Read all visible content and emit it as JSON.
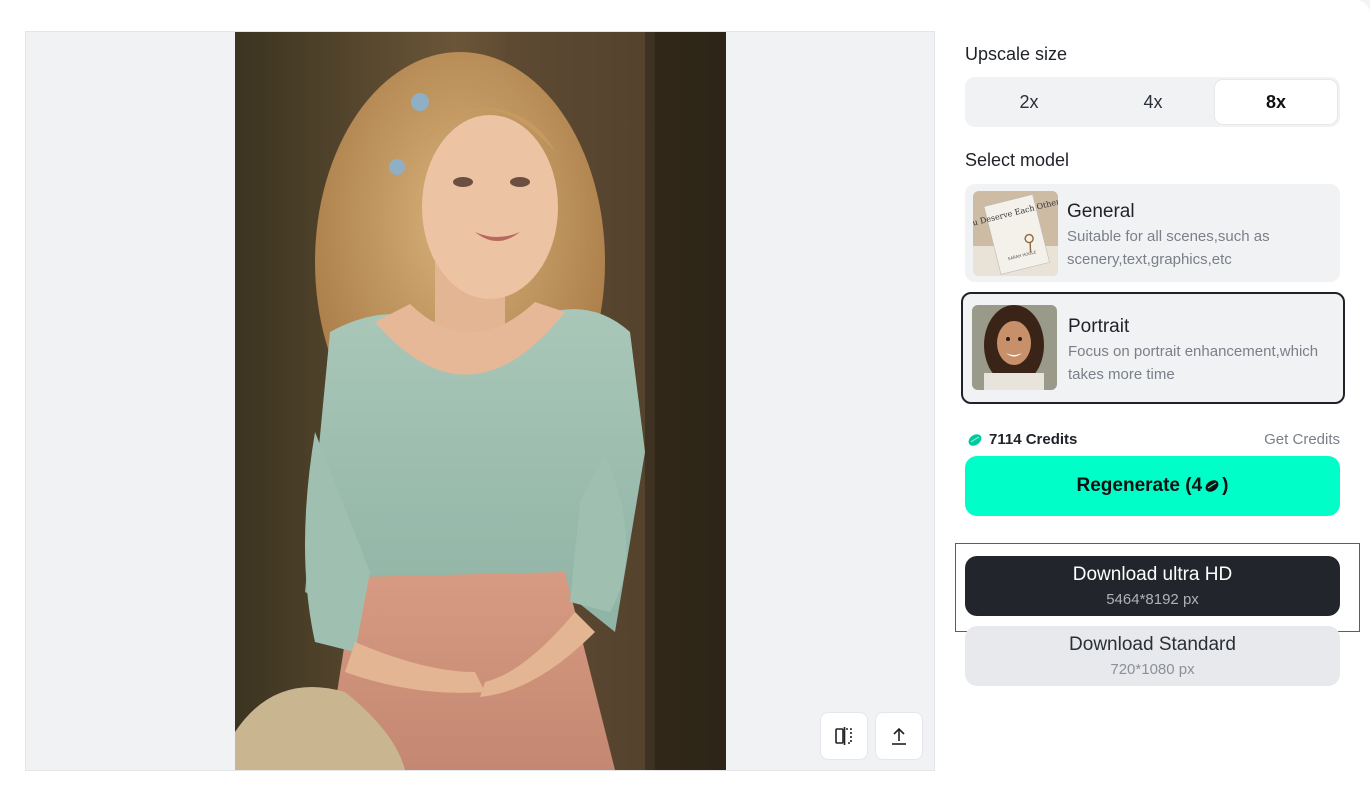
{
  "upscale": {
    "label": "Upscale size",
    "options": [
      "2x",
      "4x",
      "8x"
    ],
    "selected": "8x"
  },
  "model": {
    "label": "Select model",
    "items": [
      {
        "title": "General",
        "desc": "Suitable for all scenes,such as scenery,text,graphics,etc",
        "thumb_text": "You Deserve Each Other",
        "thumb_sub": "SARAH HOGLE"
      },
      {
        "title": "Portrait",
        "desc": "Focus on portrait enhancement,which takes more time"
      }
    ],
    "selected": "Portrait"
  },
  "credits": {
    "amount": "7114 Credits",
    "get_label": "Get Credits",
    "icon": "bean-icon",
    "color": "#00c9a0"
  },
  "regenerate": {
    "label": "Regenerate (4",
    "suffix": ")",
    "color": "#00ffc8"
  },
  "downloads": {
    "ultra": {
      "label": "Download ultra HD",
      "size": "5464*8192 px"
    },
    "standard": {
      "label": "Download Standard",
      "size": "720*1080 px"
    }
  },
  "preview_tools": [
    "compare-icon",
    "export-icon"
  ]
}
